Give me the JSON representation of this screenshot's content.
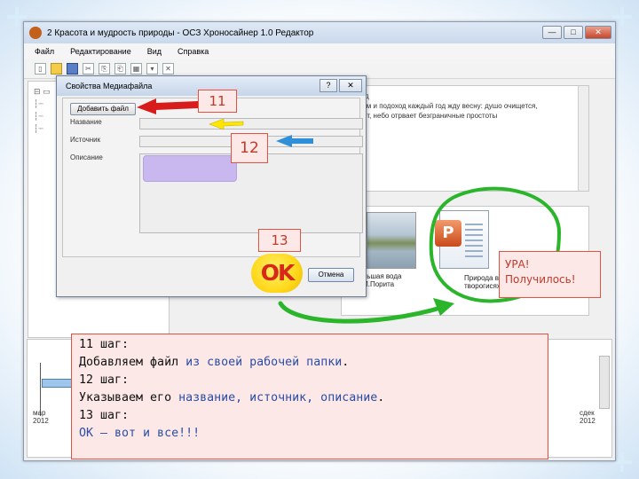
{
  "app": {
    "title": "2 Красота и мудрость природы - ОСЗ Хроносайнер 1.0 Редактор",
    "window_buttons": {
      "minimize": "—",
      "maximize": "□",
      "close": "✕"
    }
  },
  "menu": [
    "Файл",
    "Редактирование",
    "Вид",
    "Справка"
  ],
  "toolbar": {
    "icons": [
      "new-document-icon",
      "open-folder-icon",
      "save-icon",
      "cut-icon",
      "copy-icon",
      "paste-icon",
      "grid-view-icon",
      "dropdown-icon",
      "delete-icon"
    ],
    "glyphs": [
      "▯",
      "▭",
      "■",
      "✂",
      "⎘",
      "⎗",
      "▦",
      "▾",
      "✕"
    ]
  },
  "content_text": {
    "top_lines": [
      "природ",
      "стьтием и подоход каждый год жду весну: душо очищется,",
      "стекает, небо отрвает безграничные простоты"
    ],
    "section_label": "айлы"
  },
  "media": {
    "item1_caption": [
      "з. Большая вода",
      "И.И.Порита"
    ],
    "item1_prefix": "в:",
    "item2_caption": [
      "Природа в",
      "творогисях"
    ],
    "ppt_letter": "P"
  },
  "timeline": {
    "left_label": [
      "мар",
      "2012"
    ],
    "right_label": [
      "сдек",
      "2012"
    ]
  },
  "dialog": {
    "title": "Свойства Медиафайла",
    "help": "?",
    "close": "✕",
    "add_file_button": "Добавить файл",
    "fields": {
      "name": "Название",
      "source": "Источник",
      "description": "Описание"
    },
    "cancel_button": "Отмена"
  },
  "annotations": {
    "badge_11": "11",
    "badge_12": "12",
    "badge_13": "13",
    "ok_label": "OK",
    "success_line1": "УРА!",
    "success_line2": "Получилось!",
    "steps": {
      "step11_title": "11 шаг:",
      "step11_text_a": "Добавляем файл ",
      "step11_text_b": "из своей рабочей папки",
      "step11_text_c": ".",
      "step12_title": "12 шаг:",
      "step12_text_a": "Указываем его ",
      "step12_text_b": "название, источник, описание",
      "step12_text_c": ".",
      "step13_title": "13 шаг:",
      "step13_text": "ОК – вот и все!!!"
    },
    "colors": {
      "arrow_red": "#d81c1c",
      "arrow_yellow": "#ffe600",
      "arrow_blue": "#2f8fd8",
      "circle_green": "#2bb52b",
      "badge_red": "#c0392b",
      "highlight_blue": "#2c4da3"
    }
  }
}
